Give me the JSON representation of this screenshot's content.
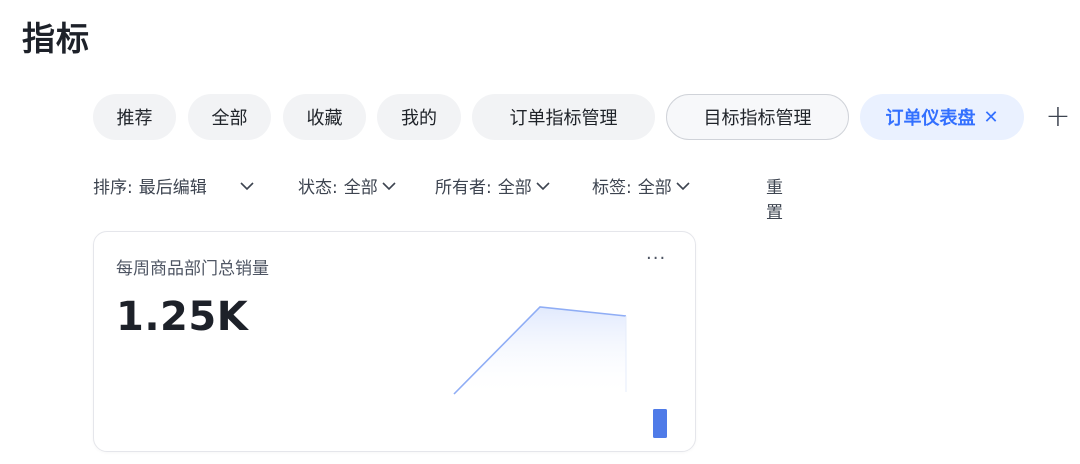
{
  "page": {
    "title": "指标"
  },
  "tabs": [
    {
      "label": "推荐",
      "style": "default"
    },
    {
      "label": "全部",
      "style": "default"
    },
    {
      "label": "收藏",
      "style": "default"
    },
    {
      "label": "我的",
      "style": "default"
    },
    {
      "label": "订单指标管理",
      "style": "default"
    },
    {
      "label": "目标指标管理",
      "style": "outlined"
    },
    {
      "label": "订单仪表盘",
      "style": "active",
      "closable": true,
      "close_icon": "close-icon"
    }
  ],
  "add_tab_icon": "plus-icon",
  "filters": {
    "sort": {
      "label": "排序:",
      "value": "最后编辑"
    },
    "status": {
      "label": "状态:",
      "value": "全部"
    },
    "owner": {
      "label": "所有者:",
      "value": "全部"
    },
    "tag": {
      "label": "标签:",
      "value": "全部"
    },
    "reset_label": "重置"
  },
  "metric_card": {
    "title": "每周商品部门总销量",
    "value": "1.25K",
    "more_icon": "more-icon",
    "sparkline_colors": {
      "line": "#8fadf5",
      "fill": "#dfe8fd",
      "bar": "#4f7be8"
    }
  },
  "colors": {
    "accent": "#3370ff",
    "active_tab_bg": "#eaf1ff",
    "tab_bg": "#f2f3f5"
  }
}
